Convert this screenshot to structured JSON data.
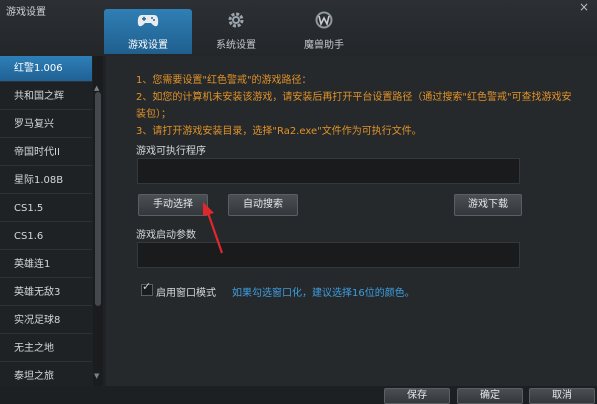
{
  "window": {
    "title": "游戏设置",
    "close_glyph": "×"
  },
  "tabs": [
    {
      "label": "游戏设置",
      "icon": "gamepad-icon",
      "active": true
    },
    {
      "label": "系统设置",
      "icon": "gear-icon",
      "active": false
    },
    {
      "label": "魔兽助手",
      "icon": "warcraft-logo-icon",
      "active": false
    }
  ],
  "sidebar": {
    "items": [
      {
        "label": "红警1.006",
        "active": true
      },
      {
        "label": "共和国之辉",
        "active": false
      },
      {
        "label": "罗马复兴",
        "active": false
      },
      {
        "label": "帝国时代II",
        "active": false
      },
      {
        "label": "星际1.08B",
        "active": false
      },
      {
        "label": "CS1.5",
        "active": false
      },
      {
        "label": "CS1.6",
        "active": false
      },
      {
        "label": "英雄连1",
        "active": false
      },
      {
        "label": "英雄无敌3",
        "active": false
      },
      {
        "label": "实况足球8",
        "active": false
      },
      {
        "label": "无主之地",
        "active": false
      },
      {
        "label": "泰坦之旅",
        "active": false
      }
    ]
  },
  "main": {
    "hints": [
      "1、您需要设置\"红色警戒\"的游戏路径：",
      "2、如您的计算机未安装该游戏，请安装后再打开平台设置路径（通过搜索\"红色警戒\"可查找游戏安",
      "装包）；",
      "3、请打开游戏安装目录，选择\"Ra2.exe\"文件作为可执行文件。"
    ],
    "exe_label": "游戏可执行程序",
    "exe_value": "",
    "manual_select": "手动选择",
    "auto_search": "自动搜索",
    "game_download": "游戏下载",
    "params_label": "游戏启动参数",
    "params_value": "",
    "window_mode_label": "启用窗口模式",
    "window_mode_checked": true,
    "window_mode_tip": "如果勾选窗口化，建议选择16位的颜色。"
  },
  "footer": {
    "save": "保存",
    "ok": "确定",
    "cancel": "取消"
  },
  "colors": {
    "accent": "#2e7fb8",
    "hint": "#e19228",
    "link": "#3d9fe0",
    "annotation_arrow": "#e0282b"
  }
}
